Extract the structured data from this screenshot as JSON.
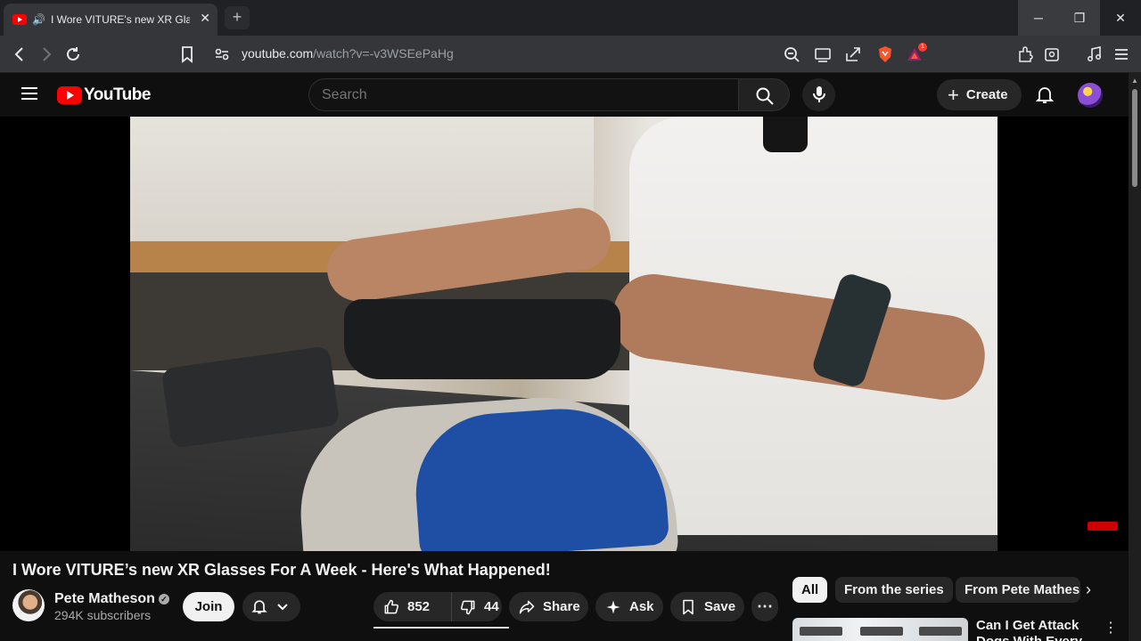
{
  "browser": {
    "tab_title": "I Wore VITURE's new XR Glass",
    "tab_audio": "🔊",
    "tab_close": "✕",
    "new_tab": "+",
    "window": {
      "minimize": "─",
      "maximize": "❐",
      "close": "✕"
    },
    "url_host": "youtube.com",
    "url_path": "/watch?v=-v3WSEePaHg",
    "rewards_count": "1"
  },
  "header": {
    "logo_text": "YouTube",
    "search_placeholder": "Search",
    "create_label": "Create",
    "create_plus": "+"
  },
  "video": {
    "title": "I Wore VITURE’s new XR Glasses For A Week - Here's What Happened!",
    "channel_name": "Pete Matheson",
    "verified": "✓",
    "subscribers": "294K subscribers",
    "join_label": "Join",
    "likes": "852",
    "dislikes": "44",
    "share_label": "Share",
    "ask_label": "Ask",
    "save_label": "Save",
    "more_label": "⋯"
  },
  "chips": {
    "all": "All",
    "series": "From the series",
    "pete": "From Pete Matheson",
    "next": "›"
  },
  "recommendation": {
    "title": "Can I Get Attack Dogs With Every",
    "menu": "⋮"
  },
  "colors": {
    "brand_red": "#ff0000",
    "background": "#0f0f0f",
    "chip_active": "#f1f1f1"
  }
}
